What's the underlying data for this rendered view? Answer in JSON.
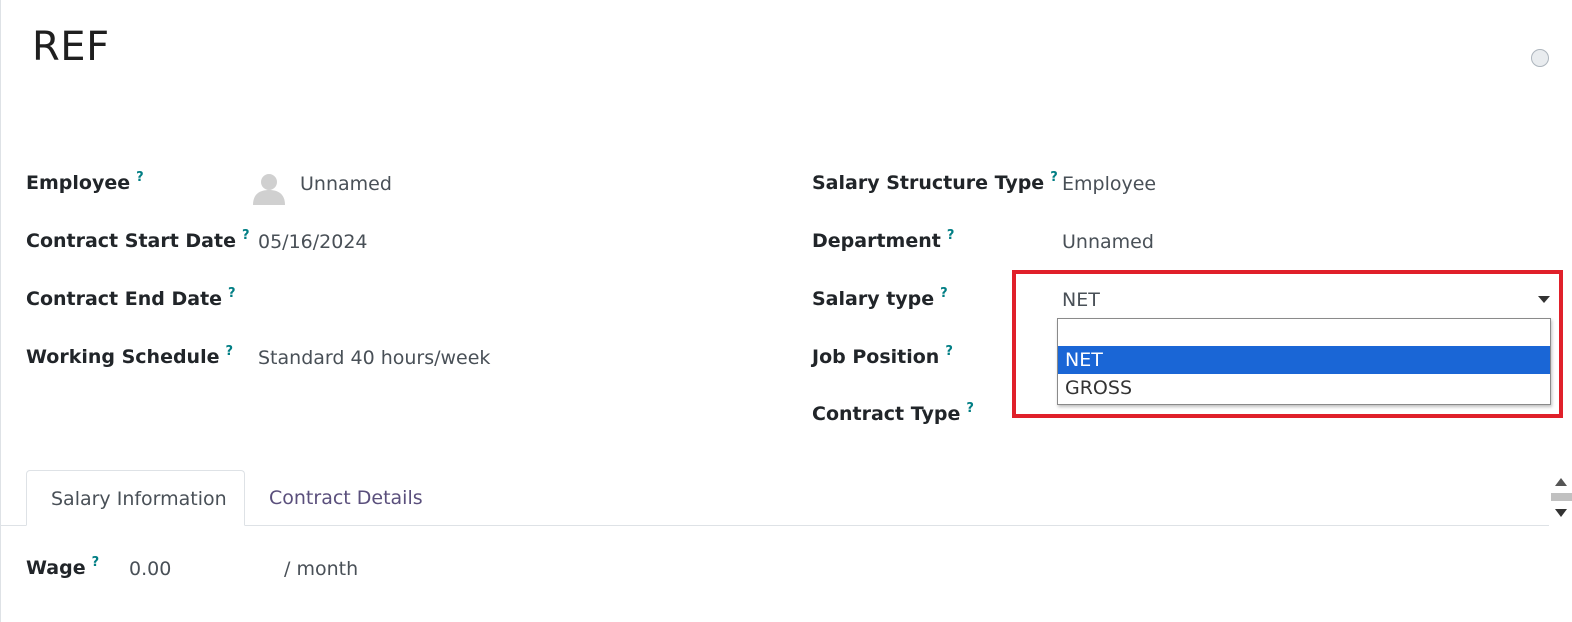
{
  "header": {
    "title": "REF"
  },
  "fields_left": {
    "employee": {
      "label": "Employee",
      "help": "?",
      "value": "Unnamed"
    },
    "contract_start_date": {
      "label": "Contract Start Date",
      "help": "?",
      "value": "05/16/2024"
    },
    "contract_end_date": {
      "label": "Contract End Date",
      "help": "?",
      "value": ""
    },
    "working_schedule": {
      "label": "Working Schedule",
      "help": "?",
      "value": "Standard 40 hours/week"
    }
  },
  "fields_right": {
    "salary_structure_type": {
      "label": "Salary Structure Type",
      "help": "?",
      "value": "Employee"
    },
    "department": {
      "label": "Department",
      "help": "?",
      "value": "Unnamed"
    },
    "salary_type": {
      "label": "Salary type",
      "help": "?",
      "value": "NET",
      "options": [
        "",
        "NET",
        "GROSS"
      ]
    },
    "job_position": {
      "label": "Job Position",
      "help": "?",
      "value": ""
    },
    "contract_type": {
      "label": "Contract Type",
      "help": "?",
      "value": ""
    }
  },
  "tabs": [
    {
      "label": "Salary Information",
      "active": true
    },
    {
      "label": "Contract Details",
      "active": false
    }
  ],
  "salary_info": {
    "wage": {
      "label": "Wage",
      "help": "?",
      "value": "0.00",
      "unit": "/ month"
    }
  },
  "colors": {
    "highlight": "#e0202a",
    "selected_option": "#1a66d6",
    "help_mark": "#017e84"
  }
}
